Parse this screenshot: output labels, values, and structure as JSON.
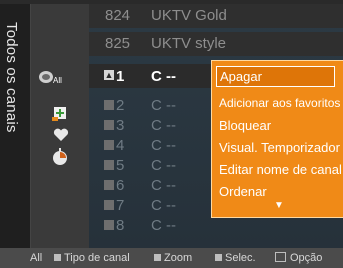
{
  "sidebar": {
    "title": "Todos os canais"
  },
  "preview_channels": [
    {
      "number": "824",
      "name": "UKTV Gold"
    },
    {
      "number": "825",
      "name": "UKTV style"
    }
  ],
  "channel_list": [
    {
      "number": "1",
      "name": "C --",
      "selected": true
    },
    {
      "number": "2",
      "name": "C --"
    },
    {
      "number": "3",
      "name": "C --"
    },
    {
      "number": "4",
      "name": "C --"
    },
    {
      "number": "5",
      "name": "C --"
    },
    {
      "number": "6",
      "name": "C --"
    },
    {
      "number": "7",
      "name": "C --"
    },
    {
      "number": "8",
      "name": "C --"
    }
  ],
  "filter_icons": [
    {
      "name": "all-channels-icon",
      "label": "All"
    },
    {
      "name": "add-favorite-icon"
    },
    {
      "name": "heart-icon"
    },
    {
      "name": "timer-icon"
    }
  ],
  "context_menu": {
    "items": [
      {
        "label": "Apagar",
        "highlighted": true
      },
      {
        "label": "Adicionar aos favoritos"
      },
      {
        "label": "Bloquear"
      },
      {
        "label": "Visual. Temporizador"
      },
      {
        "label": "Editar nome de canal"
      },
      {
        "label": "Ordenar"
      }
    ],
    "more_indicator": "▼"
  },
  "footer": {
    "all": "All",
    "channel_type": "Tipo de canal",
    "zoom": "Zoom",
    "select": "Selec.",
    "option": "Opção"
  },
  "colors": {
    "menu_bg": "#f08a17",
    "menu_highlight": "#de7508",
    "selected_box": "#d7d7d7"
  }
}
